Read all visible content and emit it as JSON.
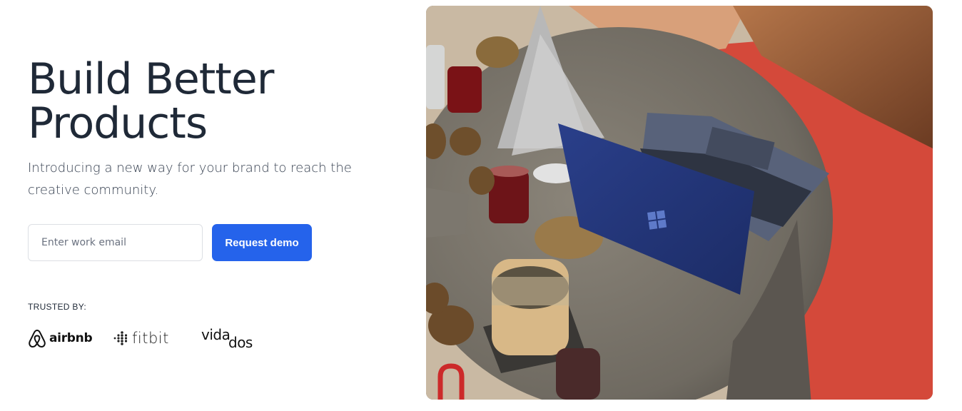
{
  "hero": {
    "title_line1": "Build Better",
    "title_line2": "Products",
    "subtitle": "Introducing a new way for your brand to reach the creative community."
  },
  "signup": {
    "email_placeholder": "Enter work email",
    "email_value": "",
    "button_label": "Request demo"
  },
  "trusted": {
    "label": "TRUSTED BY:",
    "logos": [
      {
        "name": "airbnb",
        "icon": "airbnb-logo-icon"
      },
      {
        "name": "fitbit",
        "icon": "fitbit-logo-icon"
      },
      {
        "name": "vidados",
        "icon": "vidados-logo-icon"
      }
    ]
  },
  "colors": {
    "accent": "#2563eb",
    "heading": "#1f2937",
    "body": "#374151"
  }
}
